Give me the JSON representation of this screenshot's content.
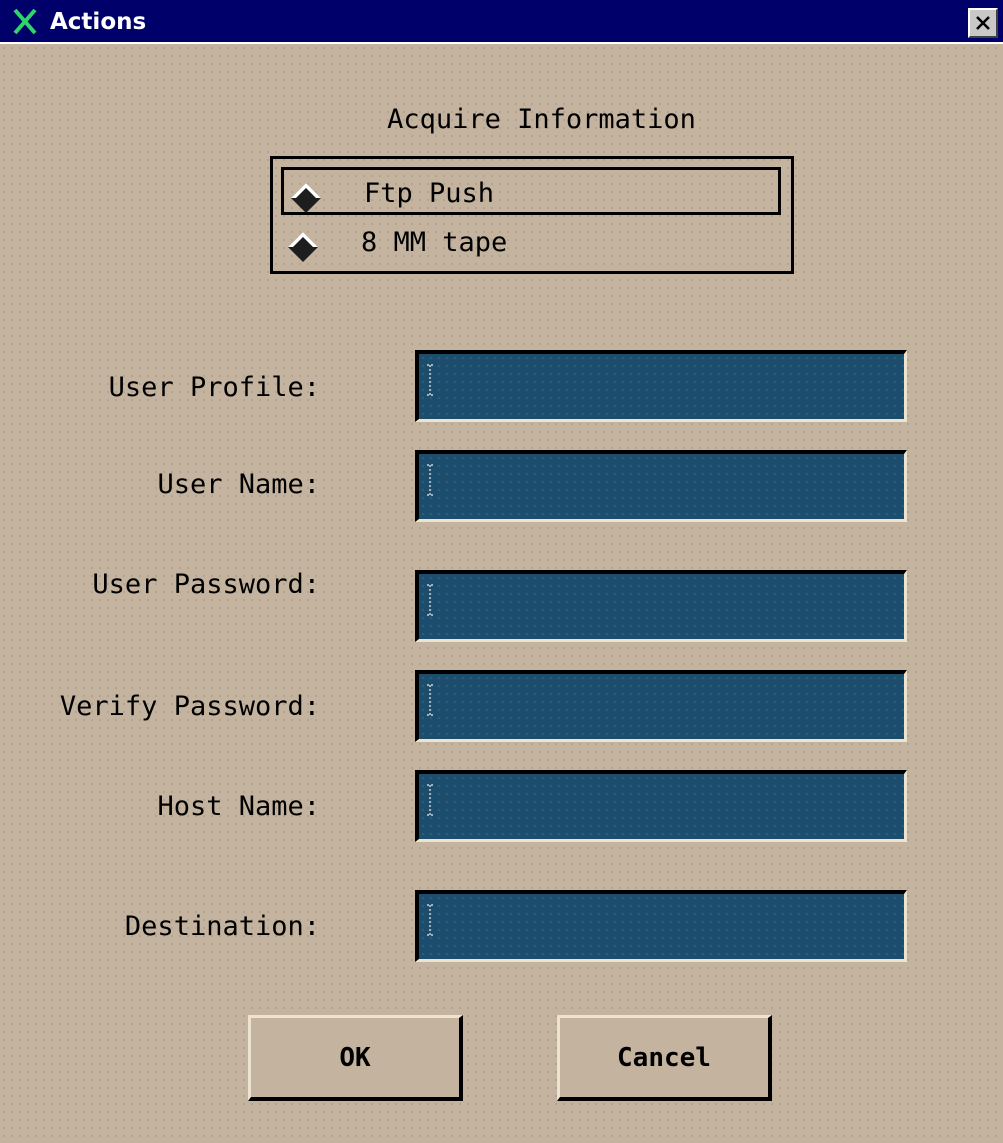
{
  "window": {
    "title": "Actions",
    "titlebar_color": "#00006b",
    "title_icon": "x-logo-icon",
    "close_icon": "close-icon"
  },
  "form": {
    "heading": "Acquire Information",
    "transfer_options": [
      {
        "label": "Ftp Push",
        "selected": true
      },
      {
        "label": "8 MM tape",
        "selected": false
      }
    ],
    "fields": [
      {
        "label": "User Profile:",
        "value": ""
      },
      {
        "label": "User Name:",
        "value": ""
      },
      {
        "label": "User Password:",
        "value": ""
      },
      {
        "label": "Verify Password:",
        "value": ""
      },
      {
        "label": "Host Name:",
        "value": ""
      },
      {
        "label": "Destination:",
        "value": ""
      }
    ],
    "field_bg_color": "#1d4d6d",
    "background_color": "#c3b39f"
  },
  "buttons": {
    "ok_label": "OK",
    "cancel_label": "Cancel"
  }
}
